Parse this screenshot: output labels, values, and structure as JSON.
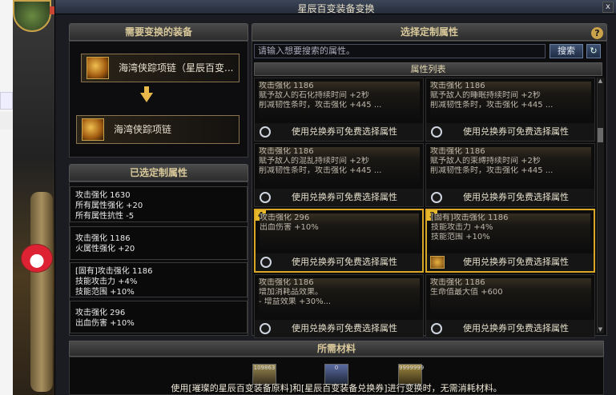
{
  "window": {
    "title": "星辰百变装备变换",
    "close": "x"
  },
  "left": {
    "equip_header": "需要变换的装备",
    "source_item": "海湾侠踪项链（星辰百变...",
    "target_item": "海湾侠踪项链",
    "selected_header": "已选定制属性",
    "selected": [
      [
        "攻击强化 1630",
        "所有属性强化 +20",
        "所有属性抗性 -5"
      ],
      [
        "攻击强化 1186",
        "火属性强化 +20"
      ],
      [
        "[固有]攻击强化 1186",
        "技能攻击力 +4%",
        "技能范围 +10%"
      ],
      [
        "攻击强化 296",
        "出血伤害 +10%"
      ]
    ]
  },
  "right": {
    "header": "选择定制属性",
    "help": "?",
    "search_placeholder": "请输入想要搜索的属性。",
    "search_button": "搜索",
    "refresh_icon": "↻",
    "list_header": "属性列表",
    "footer_text": "使用兑换券可免费选择属性",
    "cards": [
      {
        "lines": [
          "攻击强化 1186",
          "赋予敌人的石化持续时间 +2秒",
          "削减韧性条时，攻击强化 +445 ..."
        ],
        "num": ""
      },
      {
        "lines": [
          "攻击强化 1186",
          "赋予敌人的睡眠持续时间 +2秒",
          "削减韧性条时，攻击强化 +445 ..."
        ],
        "num": ""
      },
      {
        "lines": [
          "攻击强化 1186",
          "赋予敌人的混乱持续时间 +2秒",
          "削减韧性条时，攻击强化 +445 ..."
        ],
        "num": ""
      },
      {
        "lines": [
          "攻击强化 1186",
          "赋予敌人的束缚持续时间 +2秒",
          "削减韧性条时，攻击强化 +445 ..."
        ],
        "num": ""
      },
      {
        "lines": [
          "攻击强化 296",
          "出血伤害 +10%",
          ""
        ],
        "num": "4"
      },
      {
        "lines": [
          "[固有]攻击强化 1186",
          "技能攻击力 +4%",
          "技能范围 +10%"
        ],
        "num": "3"
      },
      {
        "lines": [
          "攻击强化 1186",
          "增加消耗品效果。",
          "- 增益效果 +30%..."
        ],
        "num": ""
      },
      {
        "lines": [
          "攻击强化 1186",
          "生命值最大值 +600",
          ""
        ],
        "num": ""
      }
    ]
  },
  "materials": {
    "header": "所需材料",
    "counts": [
      "109863",
      "0",
      "9999999"
    ],
    "note": "使用[璀璨的星辰百变装备原料]和[星辰百变装备兑换券]进行变换时，无需消耗材料。"
  }
}
